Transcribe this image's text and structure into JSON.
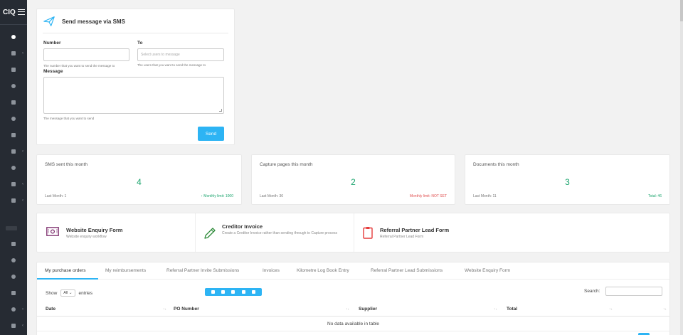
{
  "app": {
    "brand": "CIQ"
  },
  "sms": {
    "title": "Send message via SMS",
    "number_label": "Number",
    "number_value": "",
    "number_help": "The number that you want to send the message to",
    "to_label": "To",
    "to_placeholder": "Select users to message",
    "to_help": "The users that you want to send the message to",
    "message_label": "Message",
    "message_value": "",
    "message_help": "The message that you want to send",
    "send_label": "Send"
  },
  "stats": [
    {
      "title": "SMS sent this month",
      "value": "4",
      "last": "Last Month: 1",
      "right": "↑ Monthly limit: 1000",
      "right_color": "#1aa46d"
    },
    {
      "title": "Capture pages this month",
      "value": "2",
      "last": "Last Month: 36",
      "right": "Monthly limit: NOT SET",
      "right_color": "#e05050"
    },
    {
      "title": "Documents this month",
      "value": "3",
      "last": "Last Month: 11",
      "right": "Total: 46",
      "right_color": "#1aa46d"
    }
  ],
  "forms": [
    {
      "title": "Website Enquiry Form",
      "sub": "Website enquiry workflow",
      "icon": "cash-icon",
      "icon_color": "#7a2a6b"
    },
    {
      "title": "Creditor Invoice",
      "sub": "Create a Creditor Invoice rather than sending through to Capture process",
      "icon": "pencil-icon",
      "icon_color": "#2e8b3a"
    },
    {
      "title": "Referral Partner Lead Form",
      "sub": "Referral Partner Lead Form",
      "icon": "clipboard-icon",
      "icon_color": "#e53b3b"
    }
  ],
  "tabs": [
    "My purchase orders",
    "My reimbursements",
    "Referral Partner Invite Submissions",
    "Invoices",
    "Kilometre Log Book Entry",
    "Referral Partner Lead Submissions",
    "Website Enquiry Form"
  ],
  "table": {
    "show_label": "Show",
    "show_value": "All",
    "entries_label": "entries",
    "search_label": "Search:",
    "columns": [
      "Date",
      "PO Number",
      "Supplier",
      "Total"
    ],
    "empty": "No data available in table"
  },
  "colors": {
    "accent": "#2db4f4",
    "sidebar": "#262b33",
    "success": "#1aa46d",
    "danger": "#e05050"
  }
}
